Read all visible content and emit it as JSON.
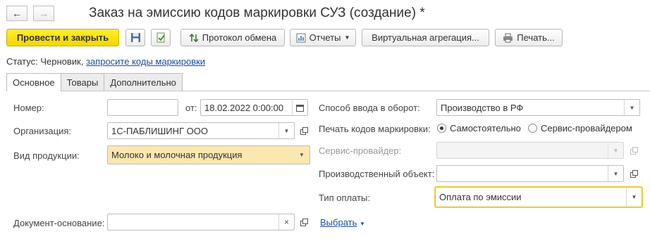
{
  "window": {
    "title": "Заказ на эмиссию кодов маркировки СУЗ (создание) *"
  },
  "nav": {
    "back_icon": "←",
    "forward_icon": "→"
  },
  "toolbar": {
    "post_close": "Провести и закрыть",
    "exchange_log": "Протокол обмена",
    "reports": "Отчеты",
    "virtual_aggregation": "Виртуальная агрегация...",
    "print": "Печать..."
  },
  "status": {
    "label": "Статус:",
    "value": "Черновик,",
    "link": "запросите коды маркировки"
  },
  "tabs": [
    "Основное",
    "Товары",
    "Дополнительно"
  ],
  "form": {
    "number_label": "Номер:",
    "number_value": "",
    "date_label": "от:",
    "date_value": "18.02.2022  0:00:00",
    "org_label": "Организация:",
    "org_value": "1С-ПАБЛИШИНГ ООО",
    "product_label": "Вид продукции:",
    "product_value": "Молоко и молочная продукция",
    "base_doc_label": "Документ-основание:",
    "base_doc_value": "",
    "select_link": "Выбрать",
    "circulation_label": "Способ ввода в оборот:",
    "circulation_value": "Производство в РФ",
    "print_codes_label": "Печать кодов маркировки:",
    "print_opt1": "Самостоятельно",
    "print_opt2": "Сервис-провайдером",
    "provider_label": "Сервис-провайдер:",
    "provider_value": "",
    "prod_object_label": "Производственный объект:",
    "prod_object_value": "",
    "payment_label": "Тип оплаты:",
    "payment_value": "Оплата по эмиссии"
  },
  "colors": {
    "primary_button": "#f2d600",
    "focus": "#e6c200",
    "highlight": "#fbe7b0",
    "link": "#1c4fa0"
  }
}
